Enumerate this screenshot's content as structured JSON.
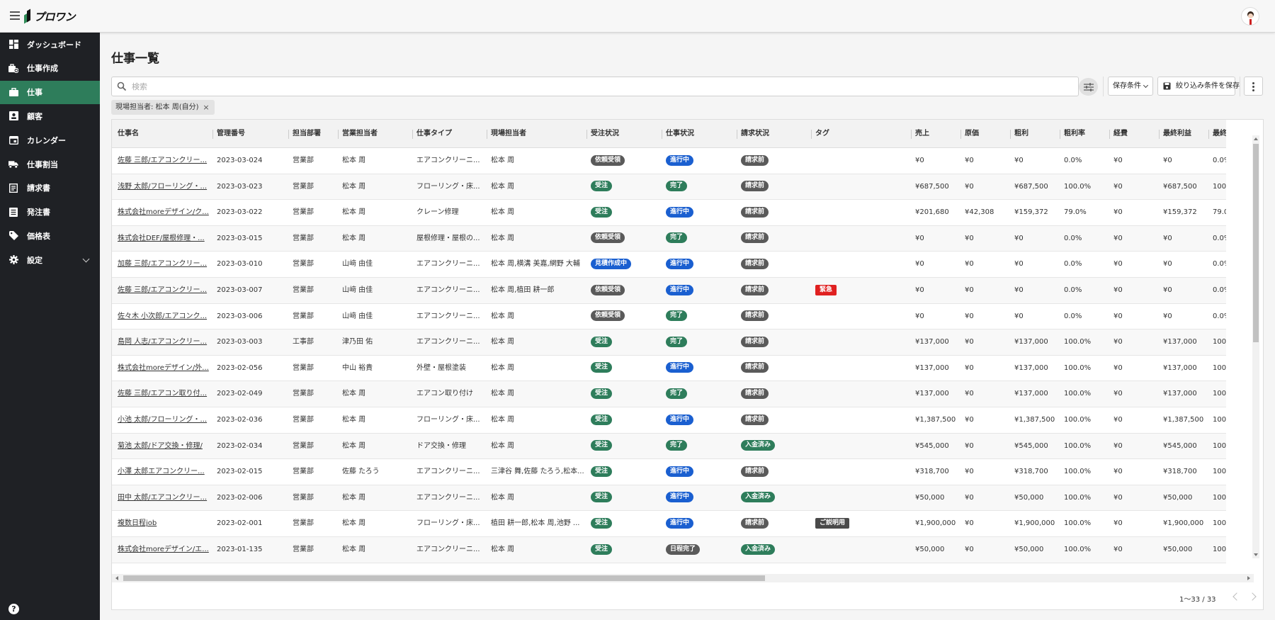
{
  "app": {
    "logo_text": "プロワン"
  },
  "sidebar": {
    "items": [
      {
        "label": "ダッシュボード",
        "icon": "dashboard-icon"
      },
      {
        "label": "仕事作成",
        "icon": "job-create-icon"
      },
      {
        "label": "仕事",
        "icon": "briefcase-icon",
        "active": true
      },
      {
        "label": "顧客",
        "icon": "contact-card-icon"
      },
      {
        "label": "カレンダー",
        "icon": "calendar-icon"
      },
      {
        "label": "仕事割当",
        "icon": "truck-icon"
      },
      {
        "label": "請求書",
        "icon": "receipt-icon"
      },
      {
        "label": "発注書",
        "icon": "document-icon"
      },
      {
        "label": "価格表",
        "icon": "price-tag-icon"
      },
      {
        "label": "設定",
        "icon": "gear-icon",
        "expandable": true
      }
    ],
    "help_label": "?"
  },
  "page": {
    "title": "仕事一覧",
    "search_placeholder": "検索",
    "save_conditions_label": "保存条件",
    "save_filter_label": "絞り込み条件を保存",
    "filter_chip": "現場担当者: 松本 周(自分)",
    "filter_chip_close": "×",
    "pagination": "1〜33 / 33"
  },
  "table": {
    "columns": [
      "仕事名",
      "管理番号",
      "担当部署",
      "営業担当者",
      "仕事タイプ",
      "現場担当者",
      "受注状況",
      "仕事状況",
      "請求状況",
      "タグ",
      "売上",
      "原価",
      "粗利",
      "粗利率",
      "経費",
      "最終利益",
      "最終"
    ],
    "rows": [
      [
        "佐藤 三郎/エアコンクリー...",
        "2023-03-024",
        "営業部",
        "松本 周",
        "エアコンクリーニ...",
        "松本 周",
        "依頼受領",
        "進行中",
        "請求前",
        "",
        "¥0",
        "¥0",
        "¥0",
        "0.0%",
        "¥0",
        "¥0",
        "0.0%"
      ],
      [
        "浅野 太郎/フローリング・...",
        "2023-03-023",
        "営業部",
        "松本 周",
        "フローリング・床...",
        "松本 周",
        "受注",
        "完了",
        "請求前",
        "",
        "¥687,500",
        "¥0",
        "¥687,500",
        "100.0%",
        "¥0",
        "¥687,500",
        "100."
      ],
      [
        "株式会社moreデザイン/ク...",
        "2023-03-022",
        "営業部",
        "松本 周",
        "クレーン修理",
        "松本 周",
        "受注",
        "進行中",
        "請求前",
        "",
        "¥201,680",
        "¥42,308",
        "¥159,372",
        "79.0%",
        "¥0",
        "¥159,372",
        "79.0"
      ],
      [
        "株式会社DEF/屋根修理・...",
        "2023-03-015",
        "営業部",
        "松本 周",
        "屋根修理・屋根の...",
        "松本 周",
        "依頼受領",
        "完了",
        "請求前",
        "",
        "¥0",
        "¥0",
        "¥0",
        "0.0%",
        "¥0",
        "¥0",
        "0.0%"
      ],
      [
        "加藤 三郎/エアコンクリー...",
        "2023-03-010",
        "営業部",
        "山﨑 由佳",
        "エアコンクリーニ...",
        "松本 周,横溝 美嘉,網野 大輔",
        "見積作成中",
        "進行中",
        "請求前",
        "",
        "¥0",
        "¥0",
        "¥0",
        "0.0%",
        "¥0",
        "¥0",
        "0.0%"
      ],
      [
        "佐藤 三郎/エアコンクリー...",
        "2023-03-007",
        "営業部",
        "山﨑 由佳",
        "エアコンクリーニ...",
        "松本 周,植田 耕一郎",
        "依頼受領",
        "進行中",
        "請求前",
        "緊急",
        "¥0",
        "¥0",
        "¥0",
        "0.0%",
        "¥0",
        "¥0",
        "0.0%"
      ],
      [
        "佐々木 小次郎/エアコンク...",
        "2023-03-006",
        "営業部",
        "山﨑 由佳",
        "エアコンクリーニ...",
        "松本 周",
        "依頼受領",
        "完了",
        "請求前",
        "",
        "¥0",
        "¥0",
        "¥0",
        "0.0%",
        "¥0",
        "¥0",
        "0.0%"
      ],
      [
        "島岡 人志/エアコンクリー...",
        "2023-03-003",
        "工事部",
        "津乃田 佑",
        "エアコンクリーニ...",
        "松本 周",
        "受注",
        "完了",
        "請求前",
        "",
        "¥137,000",
        "¥0",
        "¥137,000",
        "100.0%",
        "¥0",
        "¥137,000",
        "100."
      ],
      [
        "株式会社moreデザイン/外...",
        "2023-02-056",
        "営業部",
        "中山 裕貴",
        "外壁・屋根塗装",
        "松本 周",
        "受注",
        "進行中",
        "請求前",
        "",
        "¥137,000",
        "¥0",
        "¥137,000",
        "100.0%",
        "¥0",
        "¥137,000",
        "100."
      ],
      [
        "佐藤 三郎/エアコン取り付...",
        "2023-02-049",
        "営業部",
        "松本 周",
        "エアコン取り付け",
        "松本 周",
        "受注",
        "完了",
        "請求前",
        "",
        "¥137,000",
        "¥0",
        "¥137,000",
        "100.0%",
        "¥0",
        "¥137,000",
        "100."
      ],
      [
        "小池 太郎/フローリング・...",
        "2023-02-036",
        "営業部",
        "松本 周",
        "フローリング・床...",
        "松本 周",
        "受注",
        "進行中",
        "請求前",
        "",
        "¥1,387,500",
        "¥0",
        "¥1,387,500",
        "100.0%",
        "¥0",
        "¥1,387,500",
        "100."
      ],
      [
        "菊池 太郎/ドア交換・修理/",
        "2023-02-034",
        "営業部",
        "松本 周",
        "ドア交換・修理",
        "松本 周",
        "受注",
        "完了",
        "入金済み",
        "",
        "¥545,000",
        "¥0",
        "¥545,000",
        "100.0%",
        "¥0",
        "¥545,000",
        "100."
      ],
      [
        "小澤 太郎エアコンクリー...",
        "2023-02-015",
        "営業部",
        "佐藤 たろう",
        "エアコンクリーニ...",
        "三津谷 舞,佐藤 たろう,松本...",
        "受注",
        "進行中",
        "請求前",
        "",
        "¥318,700",
        "¥0",
        "¥318,700",
        "100.0%",
        "¥0",
        "¥318,700",
        "100."
      ],
      [
        "田中 太郎/エアコンクリー...",
        "2023-02-006",
        "営業部",
        "松本 周",
        "エアコンクリーニ...",
        "松本 周",
        "受注",
        "進行中",
        "入金済み",
        "",
        "¥50,000",
        "¥0",
        "¥50,000",
        "100.0%",
        "¥0",
        "¥50,000",
        "100."
      ],
      [
        "複数日程job",
        "2023-02-001",
        "営業部",
        "松本 周",
        "フローリング・床...",
        "植田 耕一郎,松本 周,池野 ...",
        "受注",
        "進行中",
        "請求前",
        "ご説明用",
        "¥1,900,000",
        "¥0",
        "¥1,900,000",
        "100.0%",
        "¥0",
        "¥1,900,000",
        "100."
      ],
      [
        "株式会社moreデザイン/エ...",
        "2023-01-135",
        "営業部",
        "松本 周",
        "エアコンクリーニ...",
        "松本 周",
        "受注",
        "日程完了",
        "入金済み",
        "",
        "¥50,000",
        "¥0",
        "¥50,000",
        "100.0%",
        "¥0",
        "¥50,000",
        "100."
      ]
    ]
  },
  "colors": {
    "sidebar_bg": "#1f2125",
    "active_green": "#2e7d5b",
    "badge_gray": "#5a5a5a",
    "badge_green": "#2e7d5b",
    "badge_blue": "#1a5fd0",
    "tag_red": "#e02020",
    "tag_dark": "#4a4a4a"
  }
}
